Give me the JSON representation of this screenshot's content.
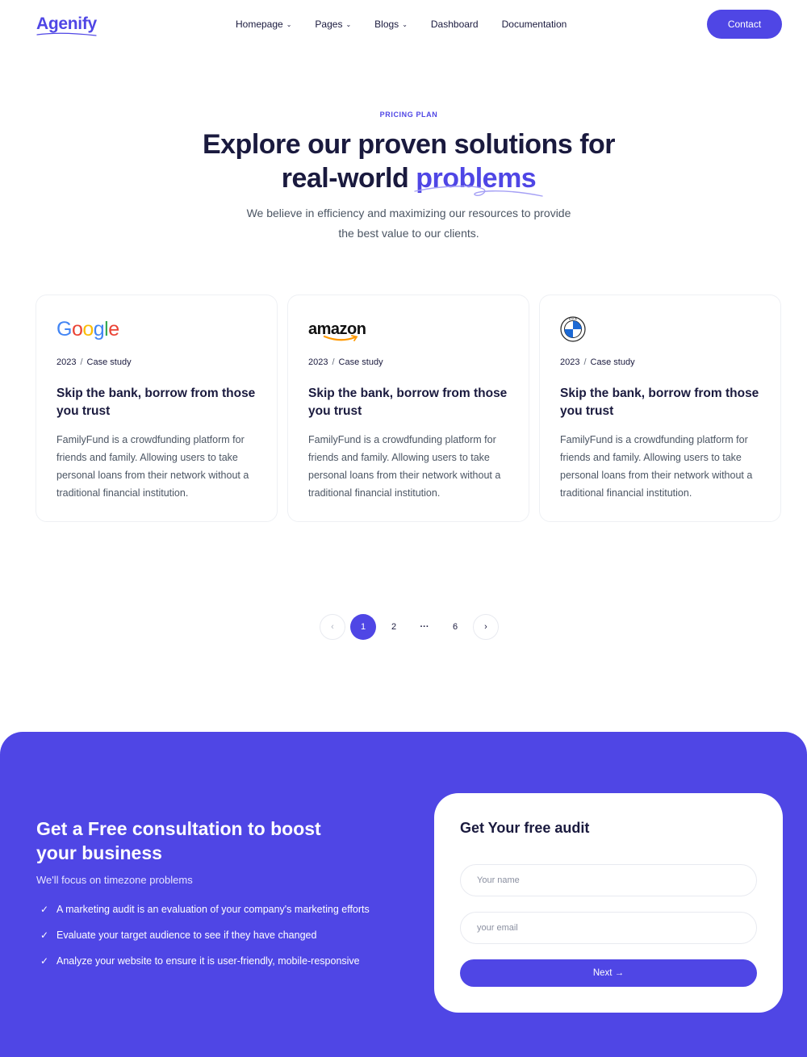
{
  "header": {
    "logo": "Agenify",
    "nav": [
      {
        "label": "Homepage",
        "dropdown": true
      },
      {
        "label": "Pages",
        "dropdown": true
      },
      {
        "label": "Blogs",
        "dropdown": true
      },
      {
        "label": "Dashboard",
        "dropdown": false
      },
      {
        "label": "Documentation",
        "dropdown": false
      }
    ],
    "contact_label": "Contact"
  },
  "hero": {
    "eyebrow": "PRICING PLAN",
    "headline_line1": "Explore our proven solutions for",
    "headline_line2_prefix": "real-world ",
    "headline_accent": "problems",
    "subtext_line1": "We believe in efficiency and maximizing our resources to provide",
    "subtext_line2": "the best value to our clients."
  },
  "cards": [
    {
      "brand": "Google",
      "brand_icon": "google-logo",
      "year": "2023",
      "category": "Case study",
      "title": "Skip the bank, borrow from those you trust",
      "description": "FamilyFund is a crowdfunding platform for friends and family. Allowing users to take personal loans from their network without a traditional financial institution."
    },
    {
      "brand": "amazon",
      "brand_icon": "amazon-logo",
      "year": "2023",
      "category": "Case study",
      "title": "Skip the bank, borrow from those you trust",
      "description": "FamilyFund is a crowdfunding platform for friends and family. Allowing users to take personal loans from their network without a traditional financial institution."
    },
    {
      "brand": "BMW",
      "brand_icon": "bmw-logo",
      "year": "2023",
      "category": "Case study",
      "title": "Skip the bank, borrow from those you trust",
      "description": "FamilyFund is a crowdfunding platform for friends and family. Allowing users to take personal loans from their network without a traditional financial institution."
    }
  ],
  "pagination": {
    "prev_icon": "chevron-left-icon",
    "pages": [
      "1",
      "2",
      "...",
      "6"
    ],
    "current": "1",
    "next_icon": "chevron-right-icon"
  },
  "cta": {
    "title": "Get a Free consultation to boost your business",
    "subtitle": "We'll focus on timezone problems",
    "points": [
      "A marketing audit is an evaluation of your company's marketing efforts",
      "Evaluate your target audience to see if they have changed",
      "Analyze your website to ensure it is user-friendly, mobile-responsive"
    ]
  },
  "form": {
    "title": "Get Your free audit",
    "name_placeholder": "Your name",
    "email_placeholder": "your email",
    "next_label": "Next →"
  },
  "colors": {
    "accent": "#4f46e5",
    "text_dark": "#1a1a3e",
    "text_muted": "#4b5563"
  }
}
